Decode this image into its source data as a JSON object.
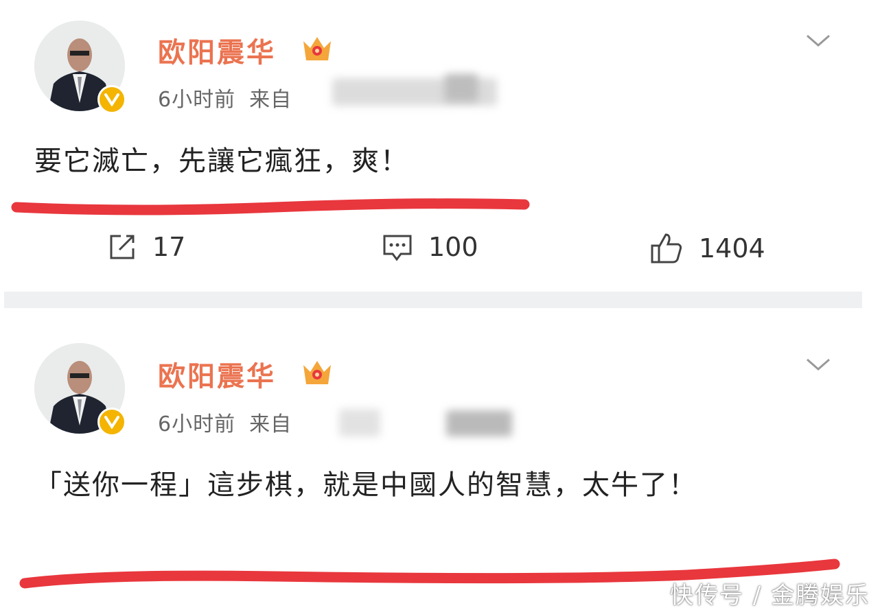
{
  "posts": [
    {
      "author": "欧阳震华",
      "time": "6小时前",
      "source_prefix": "来自",
      "content": "要它滅亡，先讓它瘋狂，爽！",
      "actions": {
        "repost": "17",
        "comment": "100",
        "like": "1404"
      }
    },
    {
      "author": "欧阳震华",
      "time": "6小时前",
      "source_prefix": "来自",
      "content": "「送你一程」這步棋，就是中國人的智慧，太牛了！"
    }
  ],
  "watermark": "快传号 / 金腾娱乐",
  "colors": {
    "username": "#eb7350",
    "annotation_line": "#e8373d",
    "verified_badge": "#f4b400"
  }
}
